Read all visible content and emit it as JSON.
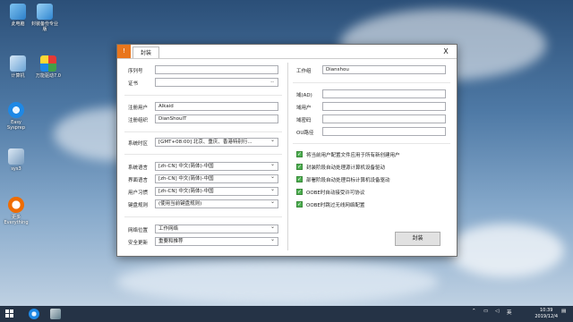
{
  "desktop": {
    "icons": [
      {
        "label": "此电脑"
      },
      {
        "label": "封装备份专业版"
      },
      {
        "label": "计算机"
      },
      {
        "label": "万能驱动7.0"
      },
      {
        "label": "Easy Sysprep"
      },
      {
        "label": "sys3"
      },
      {
        "label": "更多 Everything"
      }
    ]
  },
  "window": {
    "app_icon": "!",
    "tab_label": "封装",
    "close_glyph": "X",
    "browse_glyph": "..",
    "left": {
      "serial_label": "序列号",
      "serial_value": "",
      "cert_label": "证书",
      "cert_value": "",
      "reg_user_label": "注册用户",
      "reg_user_value": "Alkaid",
      "reg_org_label": "注册组织",
      "reg_org_value": "DianShouIT",
      "timezone_label": "系统时区",
      "timezone_value": "[GMT+08:00] 北京、重庆、香港特别行...",
      "sys_lang_label": "系统语言",
      "sys_lang_value": "[zh-CN] 中文(简体)-中国",
      "ui_lang_label": "界面语言",
      "ui_lang_value": "[zh-CN] 中文(简体)-中国",
      "user_locale_label": "用户习惯",
      "user_locale_value": "[zh-CN] 中文(简体)-中国",
      "keyboard_label": "键盘规则",
      "keyboard_value": "(使用当前键盘规则)",
      "network_label": "网络位置",
      "network_value": "工作网络",
      "update_label": "安全更新",
      "update_value": "重要和推荐"
    },
    "right": {
      "workgroup_label": "工作组",
      "workgroup_value": "Dianshou",
      "domain_label": "域(AD)",
      "domain_value": "",
      "domain_user_label": "域用户",
      "domain_user_value": "",
      "domain_pwd_label": "域密码",
      "domain_pwd_value": "",
      "ou_label": "OU路径",
      "ou_value": "",
      "options": [
        {
          "label": "将当前用户配置文件应用于所有新创建用户",
          "checked": true
        },
        {
          "label": "封装阶段自动处理源计算机设备驱动",
          "checked": true
        },
        {
          "label": "部署阶段自动处理目标计算机设备驱动",
          "checked": true
        },
        {
          "label": "OOBE时自动接受许可协议",
          "checked": true
        },
        {
          "label": "OOBE时跳过无线网络配置",
          "checked": true
        }
      ],
      "seal_button": "封装"
    }
  },
  "taskbar": {
    "ime": "英",
    "time": "10:39",
    "date": "2019/12/4"
  }
}
